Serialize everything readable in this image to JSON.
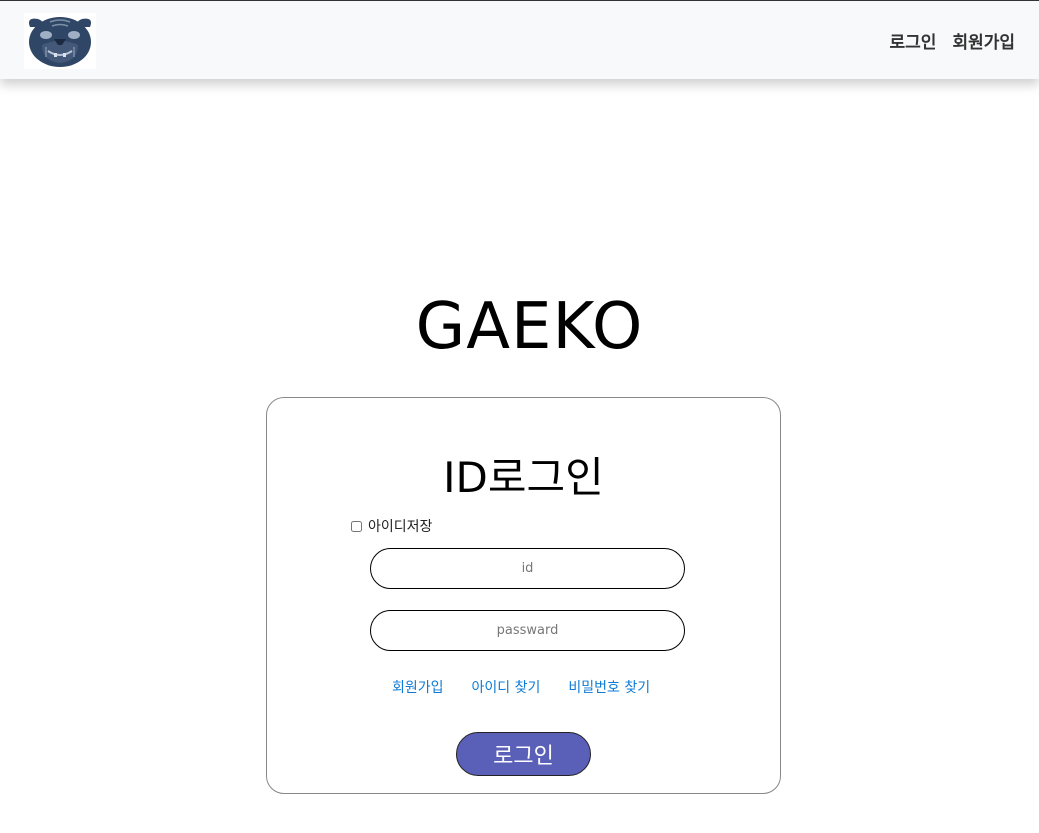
{
  "header": {
    "logo_icon": "bulldog-logo-icon",
    "nav": {
      "login_label": "로그인",
      "signup_label": "회원가입"
    }
  },
  "main": {
    "brand_title": "GAEKO",
    "login_card": {
      "heading": "ID로그인",
      "remember_label": "아이디저장",
      "remember_checked": false,
      "id_placeholder": "id",
      "id_value": "",
      "password_placeholder": "passward",
      "password_value": "",
      "links": {
        "signup": "회원가입",
        "find_id": "아이디 찾기",
        "find_password": "비밀번호 찾기"
      },
      "submit_label": "로그인"
    }
  },
  "colors": {
    "navbar_bg": "#f8f9fa",
    "link": "#0d7bd6",
    "button_bg": "#5a5fb7",
    "logo_dark": "#2f4666"
  }
}
